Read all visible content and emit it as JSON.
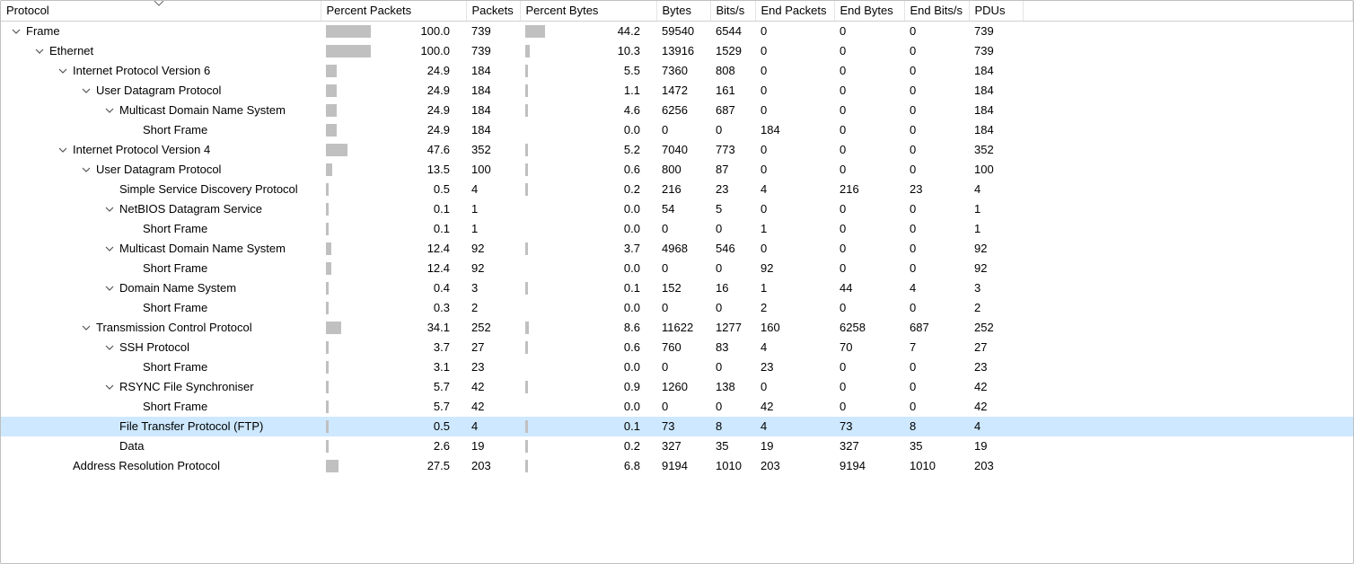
{
  "columns": {
    "protocol": "Protocol",
    "percent_packets": "Percent Packets",
    "packets": "Packets",
    "percent_bytes": "Percent Bytes",
    "bytes": "Bytes",
    "bits_s": "Bits/s",
    "end_packets": "End Packets",
    "end_bytes": "End Bytes",
    "end_bits_s": "End Bits/s",
    "pdus": "PDUs"
  },
  "rows": [
    {
      "indent": 0,
      "caret": true,
      "label": "Frame",
      "pp": "100.0",
      "pp_pct": 100,
      "packets": "739",
      "pb": "44.2",
      "pb_pct": 44.2,
      "bytes": "59540",
      "bits": "6544",
      "endp": "0",
      "endb": "0",
      "endbits": "0",
      "pdus": "739",
      "selected": false
    },
    {
      "indent": 1,
      "caret": true,
      "label": "Ethernet",
      "pp": "100.0",
      "pp_pct": 100,
      "packets": "739",
      "pb": "10.3",
      "pb_pct": 10.3,
      "bytes": "13916",
      "bits": "1529",
      "endp": "0",
      "endb": "0",
      "endbits": "0",
      "pdus": "739",
      "selected": false
    },
    {
      "indent": 2,
      "caret": true,
      "label": "Internet Protocol Version 6",
      "pp": "24.9",
      "pp_pct": 24.9,
      "packets": "184",
      "pb": "5.5",
      "pb_pct": 5.5,
      "bytes": "7360",
      "bits": "808",
      "endp": "0",
      "endb": "0",
      "endbits": "0",
      "pdus": "184",
      "selected": false
    },
    {
      "indent": 3,
      "caret": true,
      "label": "User Datagram Protocol",
      "pp": "24.9",
      "pp_pct": 24.9,
      "packets": "184",
      "pb": "1.1",
      "pb_pct": 1.1,
      "bytes": "1472",
      "bits": "161",
      "endp": "0",
      "endb": "0",
      "endbits": "0",
      "pdus": "184",
      "selected": false
    },
    {
      "indent": 4,
      "caret": true,
      "label": "Multicast Domain Name System",
      "pp": "24.9",
      "pp_pct": 24.9,
      "packets": "184",
      "pb": "4.6",
      "pb_pct": 4.6,
      "bytes": "6256",
      "bits": "687",
      "endp": "0",
      "endb": "0",
      "endbits": "0",
      "pdus": "184",
      "selected": false
    },
    {
      "indent": 5,
      "caret": false,
      "label": "Short Frame",
      "pp": "24.9",
      "pp_pct": 24.9,
      "packets": "184",
      "pb": "0.0",
      "pb_pct": 0,
      "bytes": "0",
      "bits": "0",
      "endp": "184",
      "endb": "0",
      "endbits": "0",
      "pdus": "184",
      "selected": false
    },
    {
      "indent": 2,
      "caret": true,
      "label": "Internet Protocol Version 4",
      "pp": "47.6",
      "pp_pct": 47.6,
      "packets": "352",
      "pb": "5.2",
      "pb_pct": 5.2,
      "bytes": "7040",
      "bits": "773",
      "endp": "0",
      "endb": "0",
      "endbits": "0",
      "pdus": "352",
      "selected": false
    },
    {
      "indent": 3,
      "caret": true,
      "label": "User Datagram Protocol",
      "pp": "13.5",
      "pp_pct": 13.5,
      "packets": "100",
      "pb": "0.6",
      "pb_pct": 0.6,
      "bytes": "800",
      "bits": "87",
      "endp": "0",
      "endb": "0",
      "endbits": "0",
      "pdus": "100",
      "selected": false
    },
    {
      "indent": 4,
      "caret": false,
      "label": "Simple Service Discovery Protocol",
      "pp": "0.5",
      "pp_pct": 0.5,
      "packets": "4",
      "pb": "0.2",
      "pb_pct": 0.2,
      "bytes": "216",
      "bits": "23",
      "endp": "4",
      "endb": "216",
      "endbits": "23",
      "pdus": "4",
      "selected": false
    },
    {
      "indent": 4,
      "caret": true,
      "label": "NetBIOS Datagram Service",
      "pp": "0.1",
      "pp_pct": 0.1,
      "packets": "1",
      "pb": "0.0",
      "pb_pct": 0,
      "bytes": "54",
      "bits": "5",
      "endp": "0",
      "endb": "0",
      "endbits": "0",
      "pdus": "1",
      "selected": false
    },
    {
      "indent": 5,
      "caret": false,
      "label": "Short Frame",
      "pp": "0.1",
      "pp_pct": 0.1,
      "packets": "1",
      "pb": "0.0",
      "pb_pct": 0,
      "bytes": "0",
      "bits": "0",
      "endp": "1",
      "endb": "0",
      "endbits": "0",
      "pdus": "1",
      "selected": false
    },
    {
      "indent": 4,
      "caret": true,
      "label": "Multicast Domain Name System",
      "pp": "12.4",
      "pp_pct": 12.4,
      "packets": "92",
      "pb": "3.7",
      "pb_pct": 3.7,
      "bytes": "4968",
      "bits": "546",
      "endp": "0",
      "endb": "0",
      "endbits": "0",
      "pdus": "92",
      "selected": false
    },
    {
      "indent": 5,
      "caret": false,
      "label": "Short Frame",
      "pp": "12.4",
      "pp_pct": 12.4,
      "packets": "92",
      "pb": "0.0",
      "pb_pct": 0,
      "bytes": "0",
      "bits": "0",
      "endp": "92",
      "endb": "0",
      "endbits": "0",
      "pdus": "92",
      "selected": false
    },
    {
      "indent": 4,
      "caret": true,
      "label": "Domain Name System",
      "pp": "0.4",
      "pp_pct": 0.4,
      "packets": "3",
      "pb": "0.1",
      "pb_pct": 0.1,
      "bytes": "152",
      "bits": "16",
      "endp": "1",
      "endb": "44",
      "endbits": "4",
      "pdus": "3",
      "selected": false
    },
    {
      "indent": 5,
      "caret": false,
      "label": "Short Frame",
      "pp": "0.3",
      "pp_pct": 0.3,
      "packets": "2",
      "pb": "0.0",
      "pb_pct": 0,
      "bytes": "0",
      "bits": "0",
      "endp": "2",
      "endb": "0",
      "endbits": "0",
      "pdus": "2",
      "selected": false
    },
    {
      "indent": 3,
      "caret": true,
      "label": "Transmission Control Protocol",
      "pp": "34.1",
      "pp_pct": 34.1,
      "packets": "252",
      "pb": "8.6",
      "pb_pct": 8.6,
      "bytes": "11622",
      "bits": "1277",
      "endp": "160",
      "endb": "6258",
      "endbits": "687",
      "pdus": "252",
      "selected": false
    },
    {
      "indent": 4,
      "caret": true,
      "label": "SSH Protocol",
      "pp": "3.7",
      "pp_pct": 3.7,
      "packets": "27",
      "pb": "0.6",
      "pb_pct": 0.6,
      "bytes": "760",
      "bits": "83",
      "endp": "4",
      "endb": "70",
      "endbits": "7",
      "pdus": "27",
      "selected": false
    },
    {
      "indent": 5,
      "caret": false,
      "label": "Short Frame",
      "pp": "3.1",
      "pp_pct": 3.1,
      "packets": "23",
      "pb": "0.0",
      "pb_pct": 0,
      "bytes": "0",
      "bits": "0",
      "endp": "23",
      "endb": "0",
      "endbits": "0",
      "pdus": "23",
      "selected": false
    },
    {
      "indent": 4,
      "caret": true,
      "label": "RSYNC File Synchroniser",
      "pp": "5.7",
      "pp_pct": 5.7,
      "packets": "42",
      "pb": "0.9",
      "pb_pct": 0.9,
      "bytes": "1260",
      "bits": "138",
      "endp": "0",
      "endb": "0",
      "endbits": "0",
      "pdus": "42",
      "selected": false
    },
    {
      "indent": 5,
      "caret": false,
      "label": "Short Frame",
      "pp": "5.7",
      "pp_pct": 5.7,
      "packets": "42",
      "pb": "0.0",
      "pb_pct": 0,
      "bytes": "0",
      "bits": "0",
      "endp": "42",
      "endb": "0",
      "endbits": "0",
      "pdus": "42",
      "selected": false
    },
    {
      "indent": 4,
      "caret": false,
      "label": "File Transfer Protocol (FTP)",
      "pp": "0.5",
      "pp_pct": 0.5,
      "packets": "4",
      "pb": "0.1",
      "pb_pct": 0.1,
      "bytes": "73",
      "bits": "8",
      "endp": "4",
      "endb": "73",
      "endbits": "8",
      "pdus": "4",
      "selected": true
    },
    {
      "indent": 4,
      "caret": false,
      "label": "Data",
      "pp": "2.6",
      "pp_pct": 2.6,
      "packets": "19",
      "pb": "0.2",
      "pb_pct": 0.2,
      "bytes": "327",
      "bits": "35",
      "endp": "19",
      "endb": "327",
      "endbits": "35",
      "pdus": "19",
      "selected": false
    },
    {
      "indent": 2,
      "caret": false,
      "label": "Address Resolution Protocol",
      "pp": "27.5",
      "pp_pct": 27.5,
      "packets": "203",
      "pb": "6.8",
      "pb_pct": 6.8,
      "bytes": "9194",
      "bits": "1010",
      "endp": "203",
      "endb": "9194",
      "endbits": "1010",
      "pdus": "203",
      "selected": false
    }
  ]
}
